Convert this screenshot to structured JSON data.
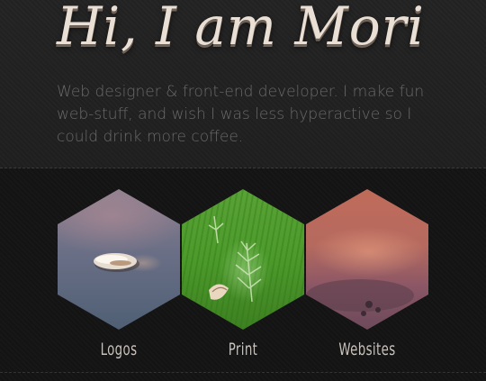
{
  "header": {
    "title": "Hi, I am Mori",
    "intro": "Web designer & front-end developer. I make fun web-stuff, and wish I was less hyperactive so I could drink more coffee."
  },
  "portfolio": {
    "items": [
      {
        "label": "Logos",
        "image": "shell-on-sand-photo"
      },
      {
        "label": "Print",
        "image": "shell-on-grass-photo"
      },
      {
        "label": "Websites",
        "image": "sunset-beach-photo"
      }
    ]
  },
  "colors": {
    "title": "#e9dfd4",
    "intro_text": "#6a6a6a",
    "background_top": "#232323",
    "background_bottom": "#141414",
    "label": "#c9c2bc"
  }
}
